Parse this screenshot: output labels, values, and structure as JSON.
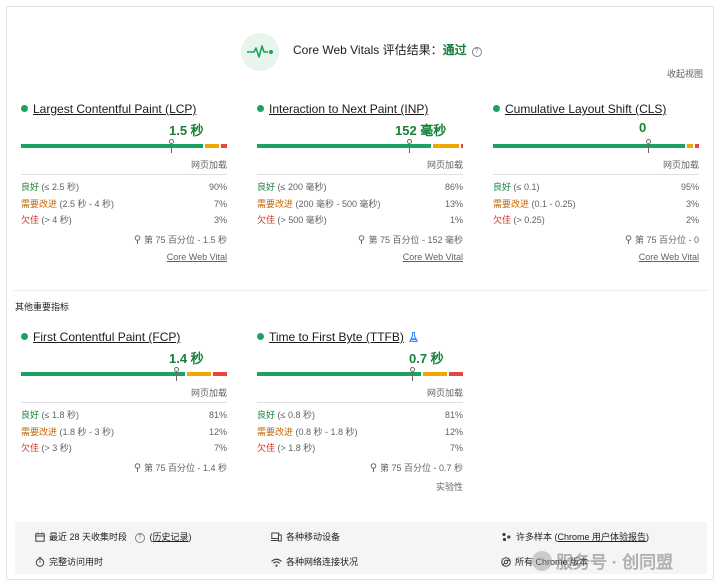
{
  "header": {
    "title_prefix": "Core Web Vitals 评估结果：",
    "title_status": "通过",
    "help": "?",
    "collapse_label": "收起视图"
  },
  "core_metrics": [
    {
      "name": "Largest Contentful Paint (LCP)",
      "value": "1.5 秒",
      "distribution": {
        "good": 90,
        "needs_improvement": 7,
        "poor": 3
      },
      "p75_position": 0.73,
      "caption": "网页加载",
      "rows": [
        {
          "label": "良好",
          "range": "(≤ 2.5 秒)",
          "percent": "90%"
        },
        {
          "label": "需要改进",
          "range": "(2.5 秒 - 4 秒)",
          "percent": "7%"
        },
        {
          "label": "欠佳",
          "range": "(> 4 秒)",
          "percent": "3%"
        }
      ],
      "percentile": "第 75 百分位 - 1.5 秒",
      "link": "Core Web Vital"
    },
    {
      "name": "Interaction to Next Paint (INP)",
      "value": "152 毫秒",
      "distribution": {
        "good": 86,
        "needs_improvement": 13,
        "poor": 1
      },
      "p75_position": 0.74,
      "caption": "网页加载",
      "rows": [
        {
          "label": "良好",
          "range": "(≤ 200 毫秒)",
          "percent": "86%"
        },
        {
          "label": "需要改进",
          "range": "(200 毫秒 - 500 毫秒)",
          "percent": "13%"
        },
        {
          "label": "欠佳",
          "range": "(> 500 毫秒)",
          "percent": "1%"
        }
      ],
      "percentile": "第 75 百分位 - 152 毫秒",
      "link": "Core Web Vital"
    },
    {
      "name": "Cumulative Layout Shift (CLS)",
      "value": "0",
      "distribution": {
        "good": 95,
        "needs_improvement": 3,
        "poor": 2
      },
      "p75_position": 0.75,
      "caption": "网页加载",
      "rows": [
        {
          "label": "良好",
          "range": "(≤ 0.1)",
          "percent": "95%"
        },
        {
          "label": "需要改进",
          "range": "(0.1 - 0.25)",
          "percent": "3%"
        },
        {
          "label": "欠佳",
          "range": "(> 0.25)",
          "percent": "2%"
        }
      ],
      "percentile": "第 75 百分位 - 0",
      "link": "Core Web Vital"
    }
  ],
  "other_title": "其他重要指标",
  "other_metrics": [
    {
      "name": "First Contentful Paint (FCP)",
      "value": "1.4 秒",
      "distribution": {
        "good": 81,
        "needs_improvement": 12,
        "poor": 7
      },
      "p75_position": 0.75,
      "caption": "网页加载",
      "rows": [
        {
          "label": "良好",
          "range": "(≤ 1.8 秒)",
          "percent": "81%"
        },
        {
          "label": "需要改进",
          "range": "(1.8 秒 - 3 秒)",
          "percent": "12%"
        },
        {
          "label": "欠佳",
          "range": "(> 3 秒)",
          "percent": "7%"
        }
      ],
      "percentile": "第 75 百分位 - 1.4 秒"
    },
    {
      "name": "Time to First Byte (TTFB)",
      "value": "0.7 秒",
      "experimental": true,
      "distribution": {
        "good": 81,
        "needs_improvement": 12,
        "poor": 7
      },
      "p75_position": 0.75,
      "caption": "网页加载",
      "rows": [
        {
          "label": "良好",
          "range": "(≤ 0.8 秒)",
          "percent": "81%"
        },
        {
          "label": "需要改进",
          "range": "(0.8 秒 - 1.8 秒)",
          "percent": "12%"
        },
        {
          "label": "欠佳",
          "range": "(> 1.8 秒)",
          "percent": "7%"
        }
      ],
      "percentile": "第 75 百分位 - 0.7 秒",
      "lab_label": "实验性"
    }
  ],
  "footer": {
    "period": "最近 28 天收集时段",
    "history": "历史记录",
    "devices": "各种移动设备",
    "samples_prefix": "许多样本",
    "samples_link": "Chrome 用户体验报告",
    "duration": "完整访问用时",
    "network": "各种网络连接状况",
    "chrome_versions": "所有 Chrome 版本"
  },
  "watermark": "服务号 · 创同盟",
  "colors": {
    "good": "#1aa260",
    "needs_improvement": "#f2a600",
    "poor": "#e8453c",
    "status_text": "#188038"
  }
}
